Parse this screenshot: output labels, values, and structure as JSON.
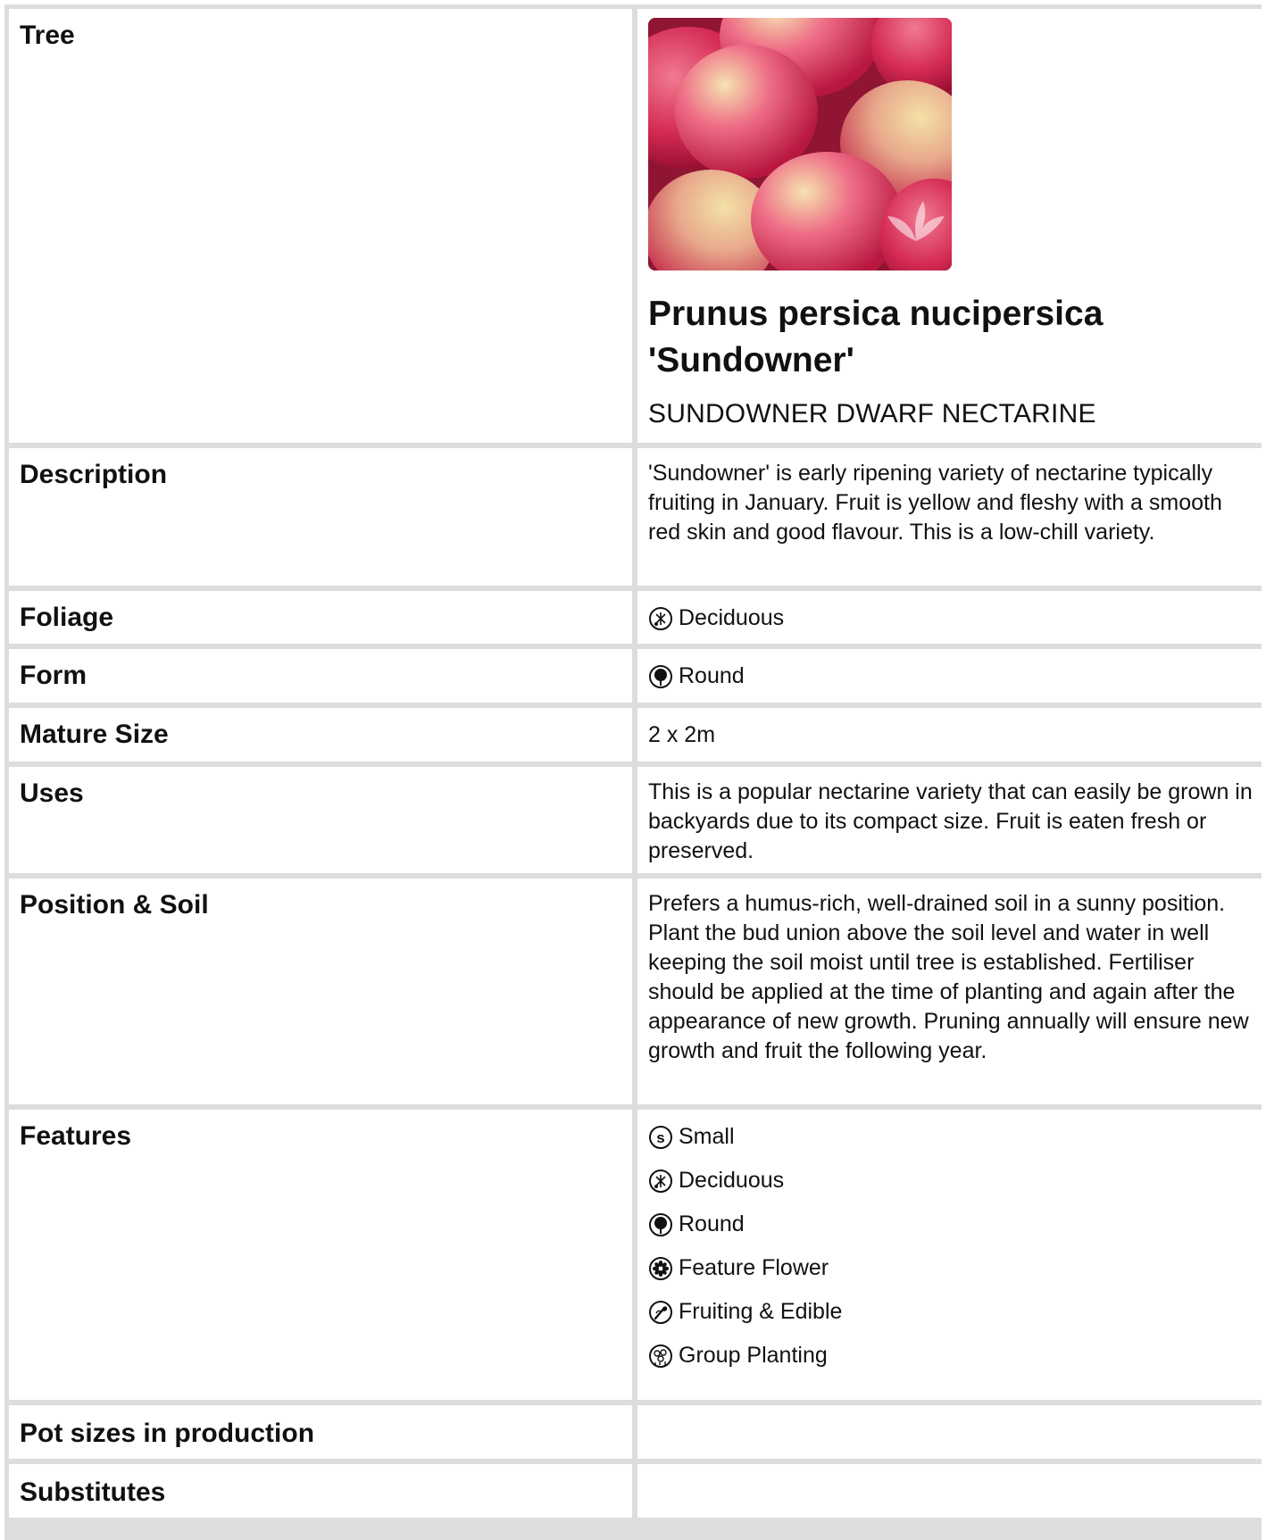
{
  "labels": {
    "tree": "Tree",
    "description": "Description",
    "foliage": "Foliage",
    "form": "Form",
    "mature_size": "Mature Size",
    "uses": "Uses",
    "position_soil": "Position & Soil",
    "features": "Features",
    "pot_sizes": "Pot sizes in production",
    "substitutes": "Substitutes"
  },
  "tree": {
    "botanical_name": "Prunus persica nucipersica 'Sundowner'",
    "common_name": "SUNDOWNER DWARF NECTARINE"
  },
  "values": {
    "description": "'Sundowner' is early ripening variety of nectarine typically fruiting in January. Fruit is yellow and fleshy with a smooth red skin and good flavour. This is a low-chill variety.",
    "foliage": {
      "icon": "deciduous-icon",
      "label": "Deciduous"
    },
    "form": {
      "icon": "round-form-icon",
      "label": "Round"
    },
    "mature_size": "2 x 2m",
    "uses": "This is a popular nectarine variety that can easily be grown in backyards due to its compact size. Fruit is eaten fresh or preserved.",
    "position_soil": "Prefers a humus-rich, well-drained soil in a sunny position. Plant the bud union above the soil level and water in well keeping the soil moist until tree is established. Fertiliser should be applied at the time of planting and again after the appearance of new growth. Pruning annually will ensure new growth and fruit the following year.",
    "features": [
      {
        "icon": "small-icon",
        "label": "Small"
      },
      {
        "icon": "deciduous-icon",
        "label": "Deciduous"
      },
      {
        "icon": "round-form-icon",
        "label": "Round"
      },
      {
        "icon": "feature-flower-icon",
        "label": "Feature Flower"
      },
      {
        "icon": "fruiting-edible-icon",
        "label": "Fruiting & Edible"
      },
      {
        "icon": "group-planting-icon",
        "label": "Group Planting"
      }
    ],
    "pot_sizes": "",
    "substitutes": ""
  },
  "colors": {
    "grid_border": "#dddddd",
    "text": "#111111",
    "photo_red": "#c6305a",
    "photo_yellow": "#efd99a"
  }
}
